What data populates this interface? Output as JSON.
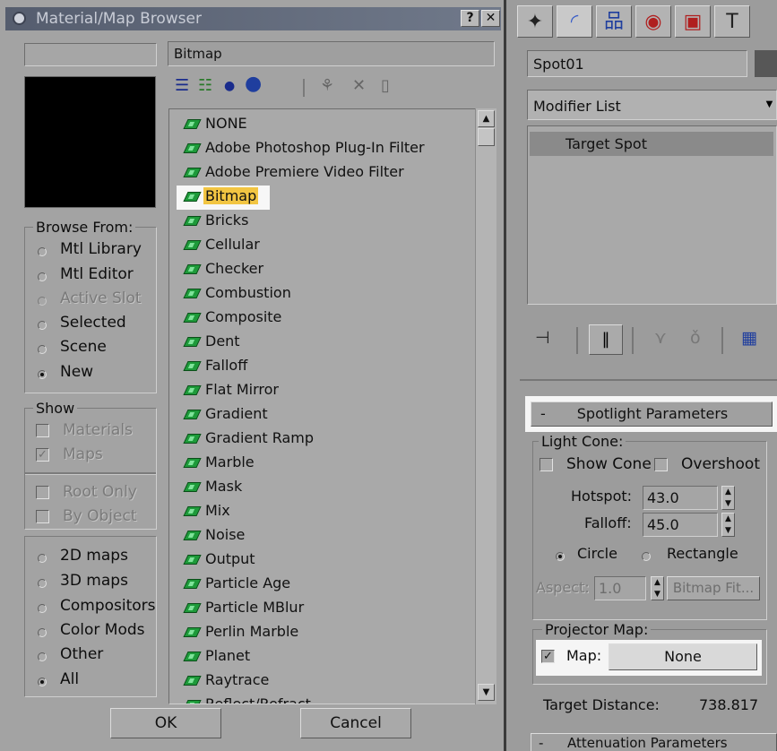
{
  "dialog": {
    "title": "Material/Map Browser",
    "help_label": "?",
    "close_label": "✕",
    "map_name": "Bitmap",
    "browse_from": {
      "label": "Browse From:",
      "options": [
        {
          "label": "Mtl Library",
          "selected": false,
          "enabled": true
        },
        {
          "label": "Mtl Editor",
          "selected": false,
          "enabled": true
        },
        {
          "label": "Active Slot",
          "selected": false,
          "enabled": false
        },
        {
          "label": "Selected",
          "selected": false,
          "enabled": true
        },
        {
          "label": "Scene",
          "selected": false,
          "enabled": true
        },
        {
          "label": "New",
          "selected": true,
          "enabled": true
        }
      ]
    },
    "show": {
      "label": "Show",
      "materials": "Materials",
      "maps": "Maps",
      "root_only": "Root Only",
      "by_object": "By Object"
    },
    "map_types": [
      {
        "label": "2D maps",
        "selected": false
      },
      {
        "label": "3D maps",
        "selected": false
      },
      {
        "label": "Compositors",
        "selected": false
      },
      {
        "label": "Color Mods",
        "selected": false
      },
      {
        "label": "Other",
        "selected": false
      },
      {
        "label": "All",
        "selected": true
      }
    ],
    "list": [
      "NONE",
      "Adobe Photoshop Plug-In Filter",
      "Adobe Premiere Video Filter",
      "Bitmap",
      "Bricks",
      "Cellular",
      "Checker",
      "Combustion",
      "Composite",
      "Dent",
      "Falloff",
      "Flat Mirror",
      "Gradient",
      "Gradient Ramp",
      "Marble",
      "Mask",
      "Mix",
      "Noise",
      "Output",
      "Particle Age",
      "Particle MBlur",
      "Perlin Marble",
      "Planet",
      "Raytrace",
      "Reflect/Refract"
    ],
    "selected_item": "Bitmap",
    "ok_label": "OK",
    "cancel_label": "Cancel"
  },
  "panel": {
    "object_name": "Spot01",
    "modifier_list": "Modifier List",
    "stack_item": "Target Spot",
    "spotlight": {
      "rollout_sign": "-",
      "title": "Spotlight Parameters",
      "light_cone_label": "Light Cone:",
      "show_cone": "Show Cone",
      "overshoot": "Overshoot",
      "hotspot_label": "Hotspot:",
      "hotspot_value": "43.0",
      "falloff_label": "Falloff:",
      "falloff_value": "45.0",
      "circle_label": "Circle",
      "rectangle_label": "Rectangle",
      "aspect_label": "Aspect:",
      "aspect_value": "1.0",
      "bitmap_fit": "Bitmap Fit...",
      "projector_label": "Projector Map:",
      "map_label": "Map:",
      "map_value": "None",
      "target_distance_label": "Target Distance:",
      "target_distance_value": "738.817"
    },
    "attenuation": {
      "rollout_sign": "-",
      "title": "Attenuation Parameters"
    }
  },
  "colors": {
    "selected_item_bg": "#f2c542",
    "map_icon": "#1e9a3a",
    "title_bar": "#555d6e"
  }
}
